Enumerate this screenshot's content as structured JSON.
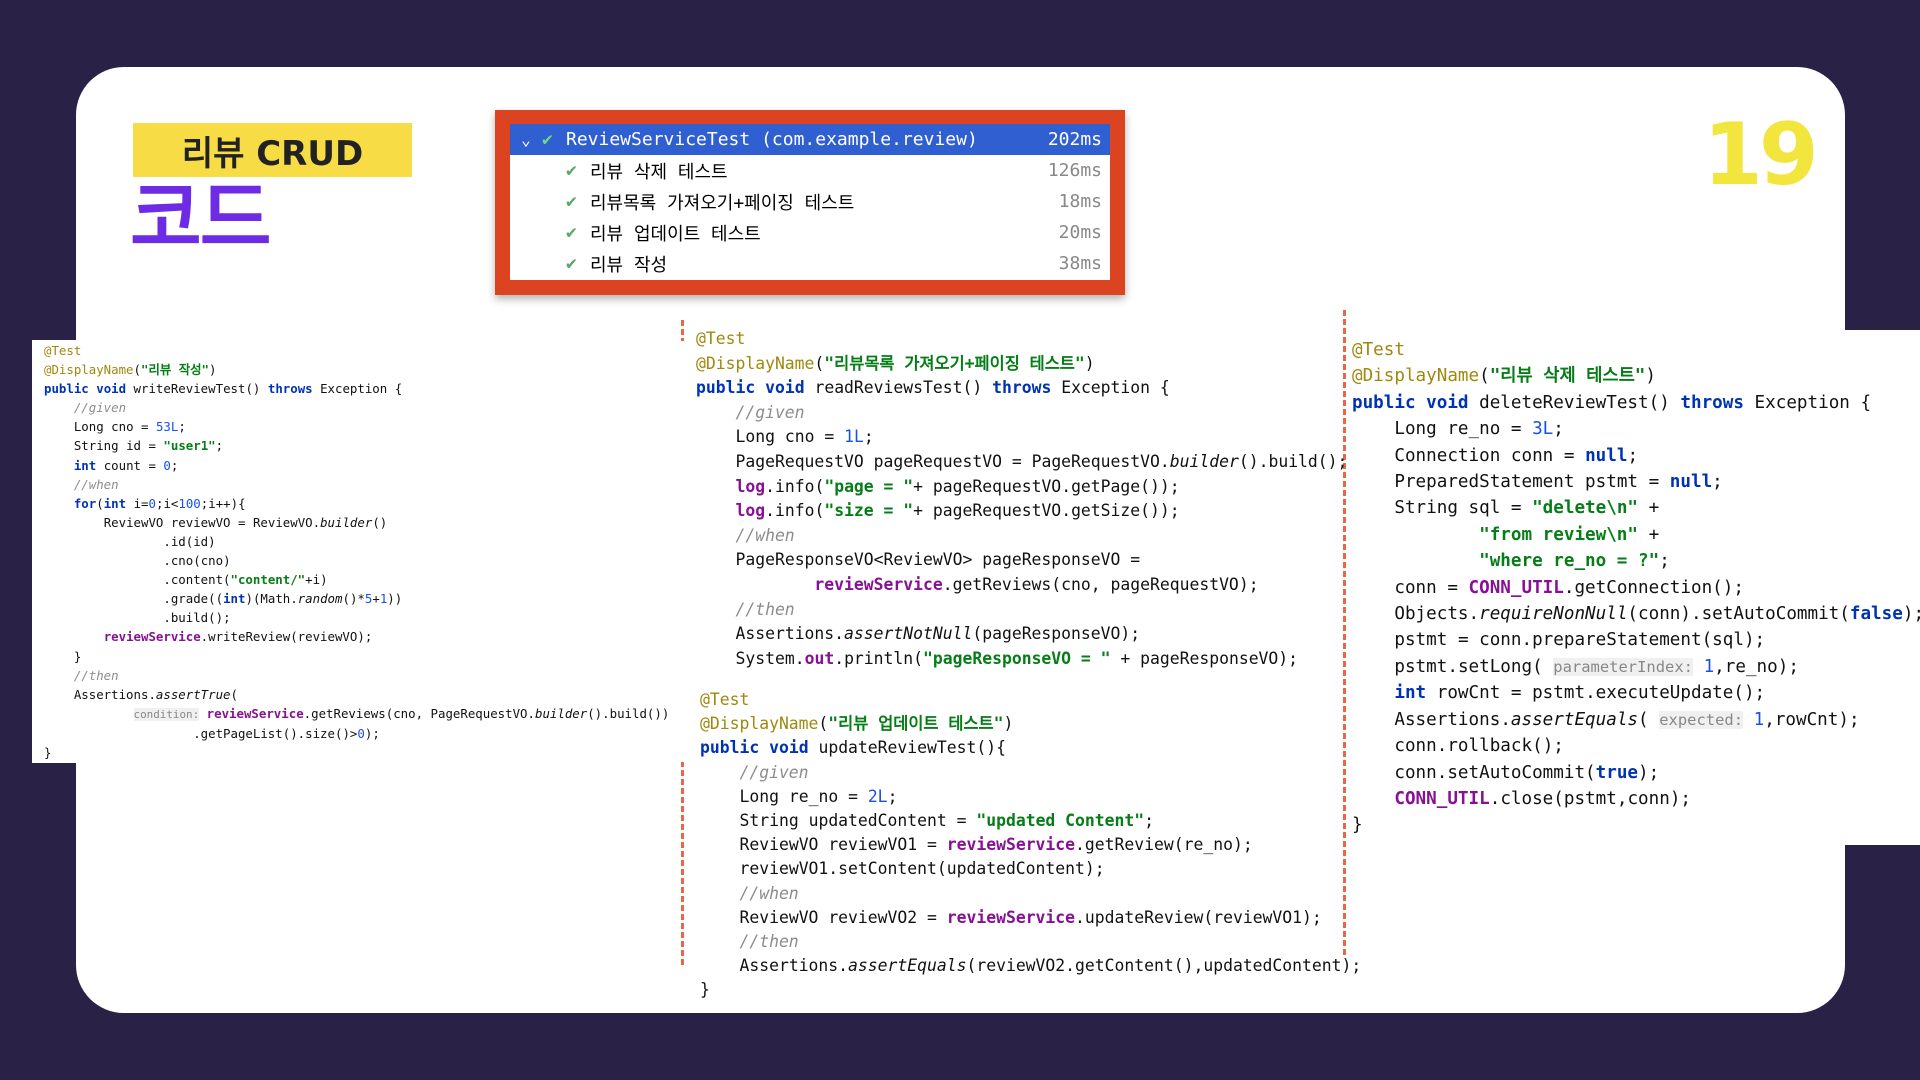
{
  "slide": {
    "badge": "리뷰 CRUD",
    "subtitle": "코드",
    "page_number": "19"
  },
  "test_runner": {
    "suite": {
      "name": "ReviewServiceTest (com.example.review)",
      "time": "202ms"
    },
    "tests": [
      {
        "name": "리뷰 삭제 테스트",
        "time": "126ms"
      },
      {
        "name": "리뷰목록 가져오기+페이징 테스트",
        "time": "18ms"
      },
      {
        "name": "리뷰 업데이트 테스트",
        "time": "20ms"
      },
      {
        "name": "리뷰 작성",
        "time": "38ms"
      }
    ]
  },
  "code": {
    "write_test": [
      "@Test",
      "@DisplayName(\"리뷰 작성\")",
      "public void writeReviewTest() throws Exception {",
      "    //given",
      "    Long cno = 53L;",
      "    String id = \"user1\";",
      "    int count = 0;",
      "    //when",
      "    for(int i=0;i<100;i++){",
      "        ReviewVO reviewVO = ReviewVO.builder()",
      "                .id(id)",
      "                .cno(cno)",
      "                .content(\"content/\"+i)",
      "                .grade((int)(Math.random()*5+1))",
      "                .build();",
      "        reviewService.writeReview(reviewVO);",
      "    }",
      "    //then",
      "    Assertions.assertTrue(",
      "            condition: reviewService.getReviews(cno, PageRequestVO.builder().build())",
      "                    .getPageList().size()>0);",
      "}"
    ],
    "read_test": [
      "@Test",
      "@DisplayName(\"리뷰목록 가져오기+페이징 테스트\")",
      "public void readReviewsTest() throws Exception {",
      "    //given",
      "    Long cno = 1L;",
      "    PageRequestVO pageRequestVO = PageRequestVO.builder().build();",
      "    log.info(\"page = \"+ pageRequestVO.getPage());",
      "    log.info(\"size = \"+ pageRequestVO.getSize());",
      "    //when",
      "    PageResponseVO<ReviewVO> pageResponseVO =",
      "            reviewService.getReviews(cno, pageRequestVO);",
      "    //then",
      "    Assertions.assertNotNull(pageResponseVO);",
      "    System.out.println(\"pageResponseVO = \" + pageResponseVO);"
    ],
    "update_test": [
      "@Test",
      "@DisplayName(\"리뷰 업데이트 테스트\")",
      "public void updateReviewTest(){",
      "    //given",
      "    Long re_no = 2L;",
      "    String updatedContent = \"updated Content\";",
      "    ReviewVO reviewVO1 = reviewService.getReview(re_no);",
      "    reviewVO1.setContent(updatedContent);",
      "    //when",
      "    ReviewVO reviewVO2 = reviewService.updateReview(reviewVO1);",
      "    //then",
      "    Assertions.assertEquals(reviewVO2.getContent(),updatedContent);",
      "}"
    ],
    "delete_test": [
      "@Test",
      "@DisplayName(\"리뷰 삭제 테스트\")",
      "public void deleteReviewTest() throws Exception {",
      "    Long re_no = 3L;",
      "    Connection conn = null;",
      "    PreparedStatement pstmt = null;",
      "    String sql = \"delete\\n\" +",
      "            \"from review\\n\" +",
      "            \"where re_no = ?\";",
      "    conn = CONN_UTIL.getConnection();",
      "    Objects.requireNonNull(conn).setAutoCommit(false);",
      "    pstmt = conn.prepareStatement(sql);",
      "    pstmt.setLong( parameterIndex: 1,re_no);",
      "    int rowCnt = pstmt.executeUpdate();",
      "    Assertions.assertEquals( expected: 1,rowCnt);",
      "    conn.rollback();",
      "    conn.setAutoCommit(true);",
      "    CONN_UTIL.close(pstmt,conn);",
      "}"
    ]
  },
  "colors": {
    "background": "#2a2147",
    "badge": "#f7dc45",
    "subtitle": "#6d2be6",
    "page_number": "#f2e53d",
    "runner_border": "#dc4321",
    "runner_selected": "#2f5fd0",
    "divider": "#e8664a"
  }
}
